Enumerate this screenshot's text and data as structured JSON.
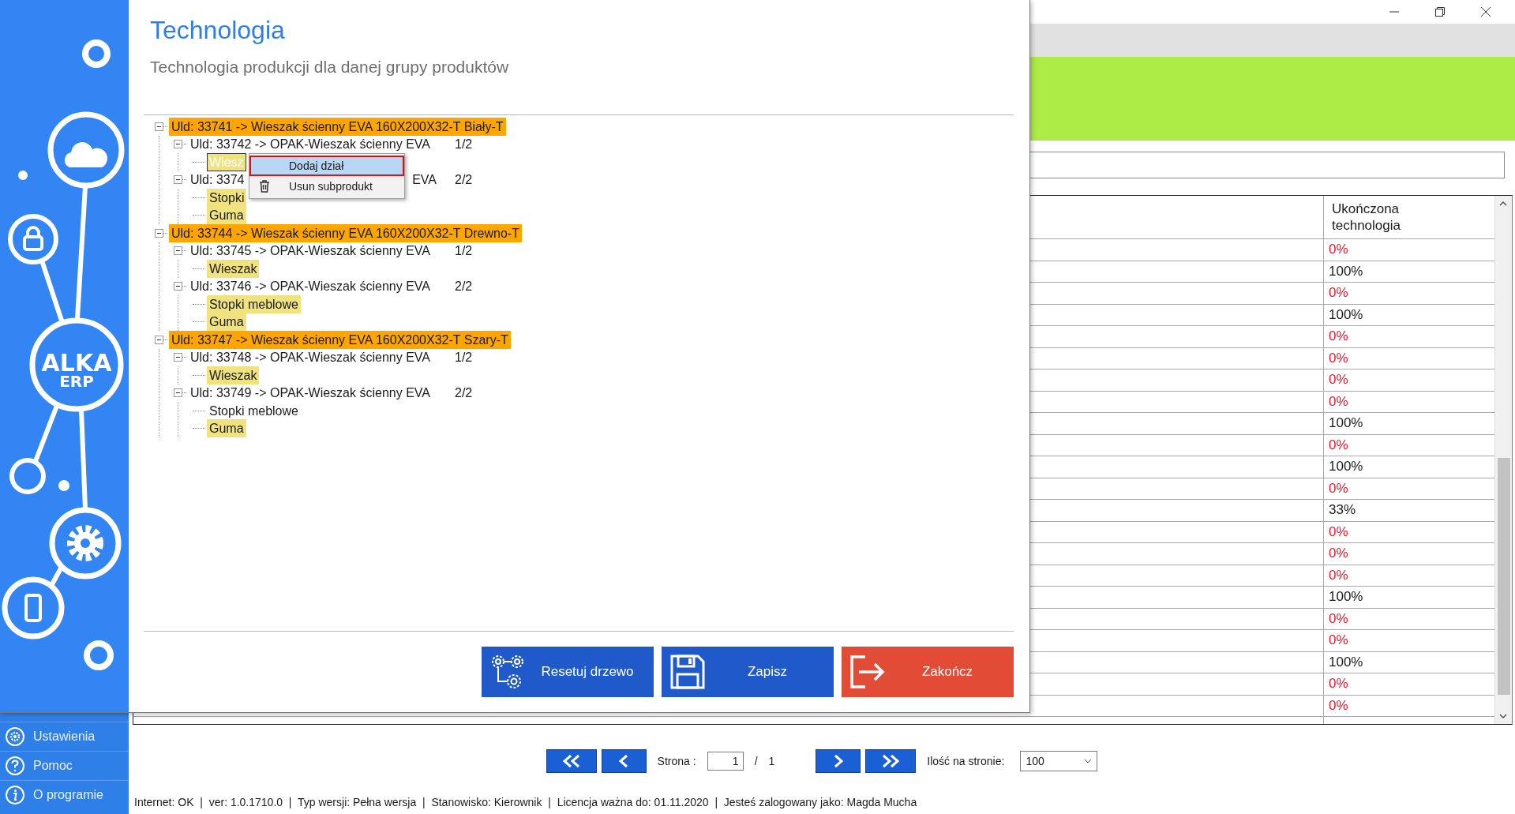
{
  "background_window": {
    "sidebar_items": [
      {
        "label": "Ustawienia",
        "kind": "settings"
      },
      {
        "label": "Pomoc",
        "kind": "help"
      },
      {
        "label": "O programie",
        "kind": "info"
      }
    ],
    "table": {
      "columns": [
        "Ukończona technologia"
      ],
      "rows": [
        {
          "completed": "0%",
          "color": "#e8192c"
        },
        {
          "completed": "100%",
          "color": "#1a1a1a"
        },
        {
          "completed": "0%",
          "color": "#e8192c"
        },
        {
          "completed": "100%",
          "color": "#1a1a1a"
        },
        {
          "completed": "0%",
          "color": "#e8192c"
        },
        {
          "completed": "0%",
          "color": "#e8192c"
        },
        {
          "completed": "0%",
          "color": "#e8192c"
        },
        {
          "completed": "0%",
          "color": "#e8192c"
        },
        {
          "completed": "100%",
          "color": "#1a1a1a"
        },
        {
          "completed": "0%",
          "color": "#e8192c"
        },
        {
          "completed": "100%",
          "color": "#1a1a1a"
        },
        {
          "completed": "0%",
          "color": "#e8192c"
        },
        {
          "completed": "33%",
          "color": "#1a1a1a"
        },
        {
          "completed": "0%",
          "color": "#e8192c"
        },
        {
          "completed": "0%",
          "color": "#e8192c"
        },
        {
          "completed": "0%",
          "color": "#e8192c"
        },
        {
          "completed": "100%",
          "color": "#1a1a1a"
        },
        {
          "completed": "0%",
          "color": "#e8192c"
        },
        {
          "completed": "0%",
          "color": "#e8192c"
        },
        {
          "completed": "100%",
          "color": "#1a1a1a"
        },
        {
          "completed": "0%",
          "color": "#e8192c"
        },
        {
          "completed": "0%",
          "color": "#e8192c"
        }
      ]
    },
    "pagination": {
      "page_label": "Strona :",
      "page": "1",
      "separator": "/",
      "total": "1",
      "per_page_label": "Ilość na stronie:",
      "per_page": "100"
    },
    "status_bar": "Internet: OK  |  ver: 1.0.1710.0  |  Typ wersji: Pełna wersja  |  Stanowisko: Kierownik  |  Licencja ważna do: 01.11.2020  |  Jesteś zalogowany jako: Magda Mucha"
  },
  "dialog": {
    "logo": [
      "ALKA",
      "ERP"
    ],
    "title": "Technologia",
    "subtitle": "Technologia produkcji dla danej grupy produktów",
    "tree": [
      {
        "label": "Uld: 33741 -> Wieszak ścienny EVA 160X200X32-T Biały-T",
        "highlight": true,
        "selected": false,
        "expanded": true,
        "children": [
          {
            "label": "Uld: 33742 -> OPAK-Wieszak ścienny EVA",
            "quantity": "1/2",
            "highlight": false,
            "selected": false,
            "expanded": true,
            "children": [
              {
                "label": "Wiesz",
                "highlight": true,
                "selected": true
              }
            ]
          },
          {
            "label": "Uld: 3374",
            "label_end": "EVA",
            "quantity": "2/2",
            "highlight": false,
            "selected": false,
            "expanded": true,
            "children": [
              {
                "label": "Stopki",
                "highlight": true,
                "selected": false
              },
              {
                "label": "Guma",
                "highlight": true,
                "selected": false
              }
            ]
          }
        ]
      },
      {
        "label": "Uld: 33744 -> Wieszak ścienny EVA 160X200X32-T Drewno-T",
        "highlight": true,
        "selected": false,
        "expanded": true,
        "children": [
          {
            "label": "Uld: 33745 -> OPAK-Wieszak ścienny EVA",
            "quantity": "1/2",
            "highlight": false,
            "selected": false,
            "expanded": true,
            "children": [
              {
                "label": "Wieszak",
                "highlight": true,
                "selected": false
              }
            ]
          },
          {
            "label": "Uld: 33746 -> OPAK-Wieszak ścienny EVA",
            "quantity": "2/2",
            "highlight": false,
            "selected": false,
            "expanded": true,
            "children": [
              {
                "label": "Stopki meblowe",
                "highlight": true,
                "selected": false
              },
              {
                "label": "Guma",
                "highlight": true,
                "selected": false
              }
            ]
          }
        ]
      },
      {
        "label": "Uld: 33747 -> Wieszak ścienny EVA 160X200X32-T Szary-T",
        "highlight": true,
        "selected": false,
        "expanded": true,
        "children": [
          {
            "label": "Uld: 33748 -> OPAK-Wieszak ścienny EVA",
            "quantity": "1/2",
            "highlight": false,
            "selected": false,
            "expanded": true,
            "children": [
              {
                "label": "Wieszak",
                "highlight": true,
                "selected": false
              }
            ]
          },
          {
            "label": "Uld: 33749 -> OPAK-Wieszak ścienny EVA",
            "quantity": "2/2",
            "highlight": false,
            "selected": false,
            "expanded": true,
            "children": [
              {
                "label": "Stopki meblowe",
                "highlight": false,
                "selected": false
              },
              {
                "label": "Guma",
                "highlight": true,
                "selected": false
              }
            ]
          }
        ]
      }
    ],
    "context_menu": {
      "items": [
        {
          "label": "Dodaj dział",
          "kind": "plain",
          "selected": true
        },
        {
          "label": "Usun subprodukt",
          "kind": "delete",
          "selected": false
        }
      ]
    },
    "buttons": [
      {
        "label": "Resetuj drzewo",
        "kind": "reset"
      },
      {
        "label": "Zapisz",
        "kind": "save"
      },
      {
        "label": "Zakończ",
        "kind": "exit"
      }
    ]
  }
}
